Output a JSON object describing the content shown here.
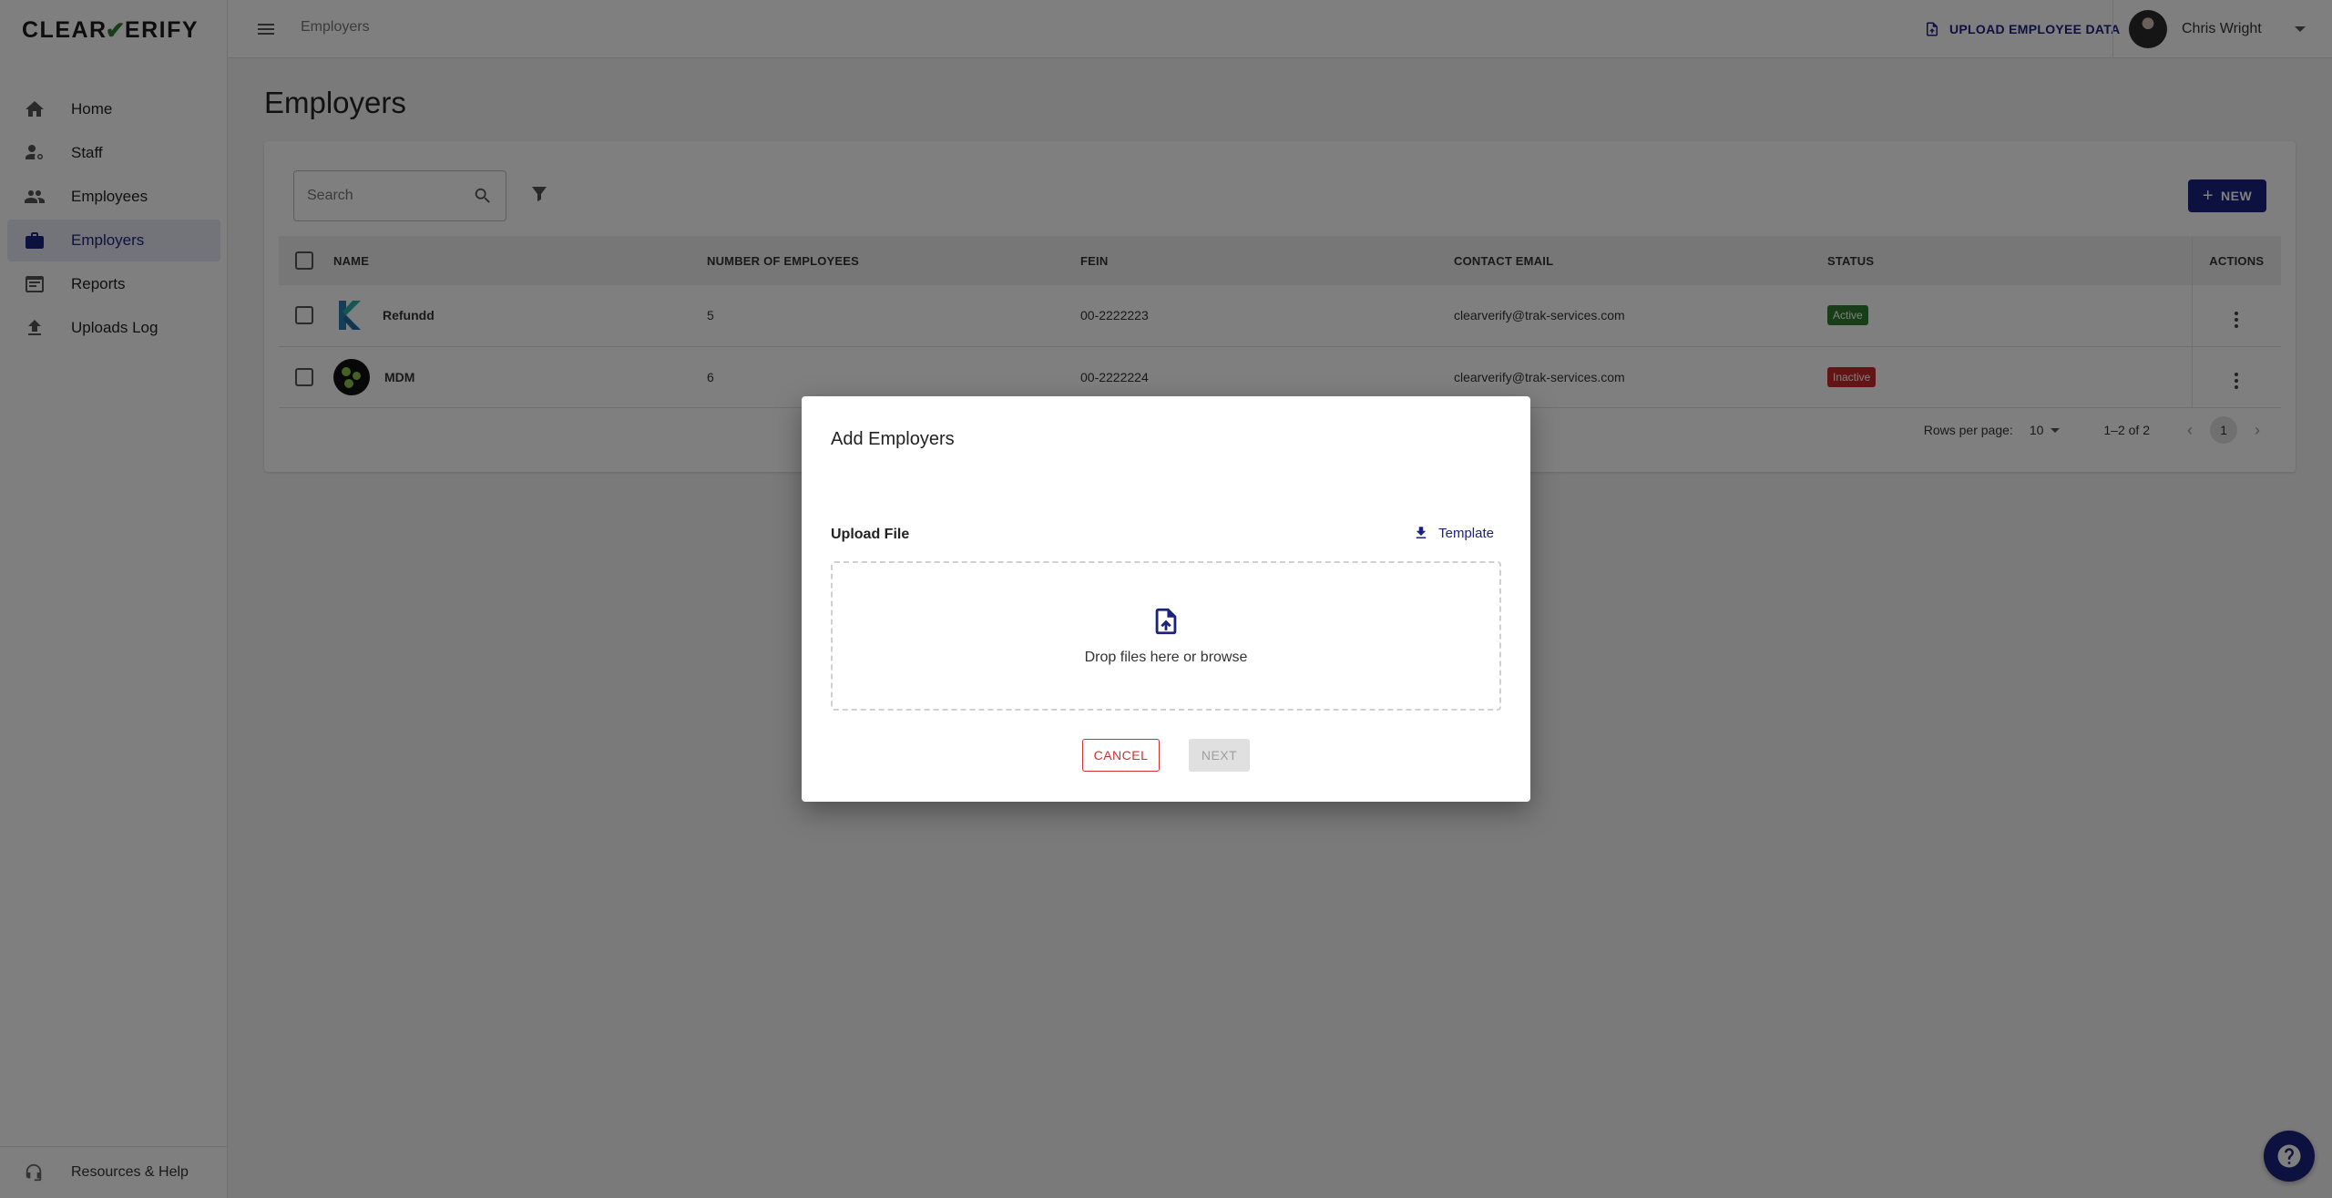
{
  "brand": {
    "logo_left": "CLEAR",
    "logo_right": "ERIFY",
    "accent": "#1a237e",
    "check_color": "#2e7d32"
  },
  "sidebar": {
    "items": [
      {
        "label": "Home",
        "icon": "home-icon",
        "active": false
      },
      {
        "label": "Staff",
        "icon": "staff-settings-icon",
        "active": false
      },
      {
        "label": "Employees",
        "icon": "people-icon",
        "active": false
      },
      {
        "label": "Employers",
        "icon": "briefcase-icon",
        "active": true
      },
      {
        "label": "Reports",
        "icon": "report-icon",
        "active": false
      },
      {
        "label": "Uploads Log",
        "icon": "upload-icon",
        "active": false
      }
    ],
    "help_label": "Resources & Help"
  },
  "header": {
    "breadcrumb": "Employers",
    "upload_label": "UPLOAD EMPLOYEE DATA",
    "user_name": "Chris Wright"
  },
  "main": {
    "title": "Employers",
    "search_placeholder": "Search",
    "new_label": "NEW",
    "columns": [
      "NAME",
      "NUMBER OF EMPLOYEES",
      "FEIN",
      "CONTACT EMAIL",
      "STATUS",
      "ACTIONS"
    ],
    "rows": [
      {
        "name": "Refundd",
        "employees": "5",
        "fein": "00-2222223",
        "email": "clearverify@trak-services.com",
        "status": "Active"
      },
      {
        "name": "MDM",
        "employees": "6",
        "fein": "00-2222224",
        "email": "clearverify@trak-services.com",
        "status": "Inactive"
      }
    ],
    "pagination": {
      "rows_per_page_label": "Rows per page:",
      "rows_per_page": "10",
      "range": "1–2 of 2",
      "page": "1"
    }
  },
  "modal": {
    "title": "Add Employers",
    "upload_label": "Upload File",
    "template_label": "Template",
    "drop_text": "Drop files here or browse",
    "cancel_label": "CANCEL",
    "next_label": "NEXT"
  },
  "colors": {
    "active": "#2e7d32",
    "inactive": "#c62828",
    "cancel": "#d32f2f"
  }
}
